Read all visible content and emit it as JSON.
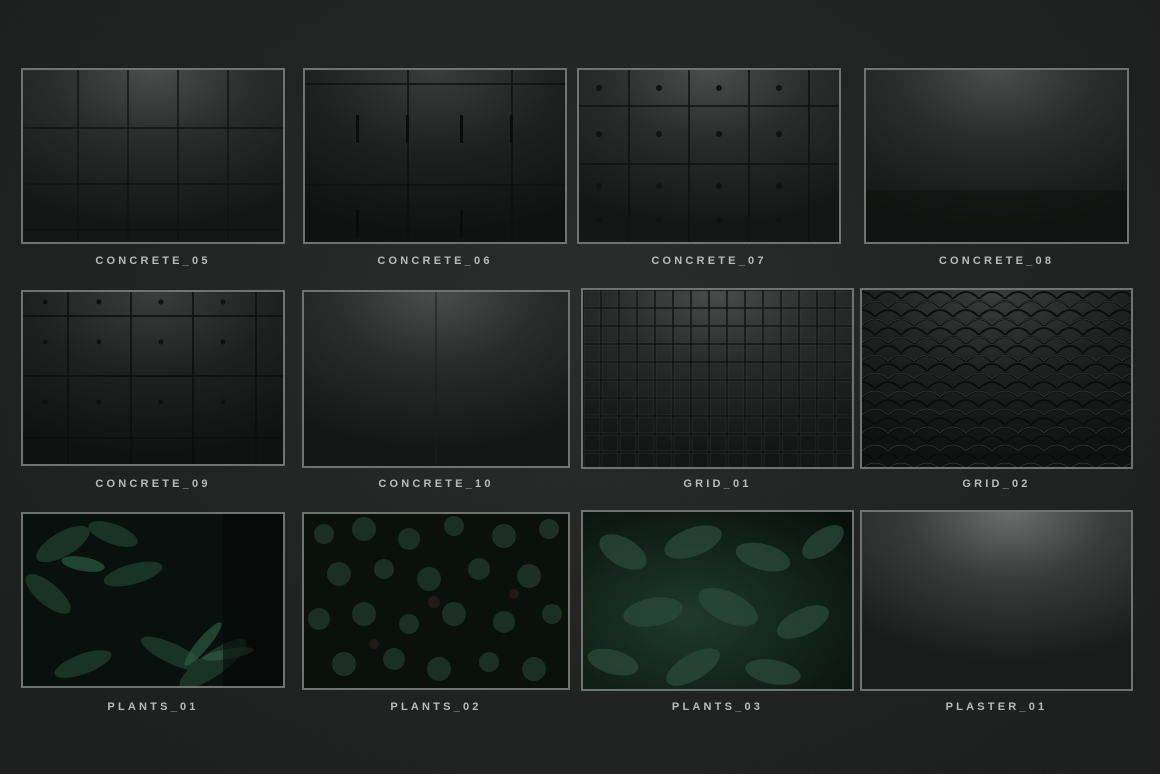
{
  "textures": [
    {
      "id": "c05",
      "label": "CONCRETE_05"
    },
    {
      "id": "c06",
      "label": "CONCRETE_06"
    },
    {
      "id": "c07",
      "label": "CONCRETE_07"
    },
    {
      "id": "c08",
      "label": "CONCRETE_08"
    },
    {
      "id": "c09",
      "label": "CONCRETE_09"
    },
    {
      "id": "c10",
      "label": "CONCRETE_10"
    },
    {
      "id": "g01",
      "label": "GRID_01"
    },
    {
      "id": "g02",
      "label": "GRID_02"
    },
    {
      "id": "p01",
      "label": "PLANTS_01"
    },
    {
      "id": "p02",
      "label": "PLANTS_02"
    },
    {
      "id": "p03",
      "label": "PLANTS_03"
    },
    {
      "id": "pl01",
      "label": "PLASTER_01"
    }
  ]
}
